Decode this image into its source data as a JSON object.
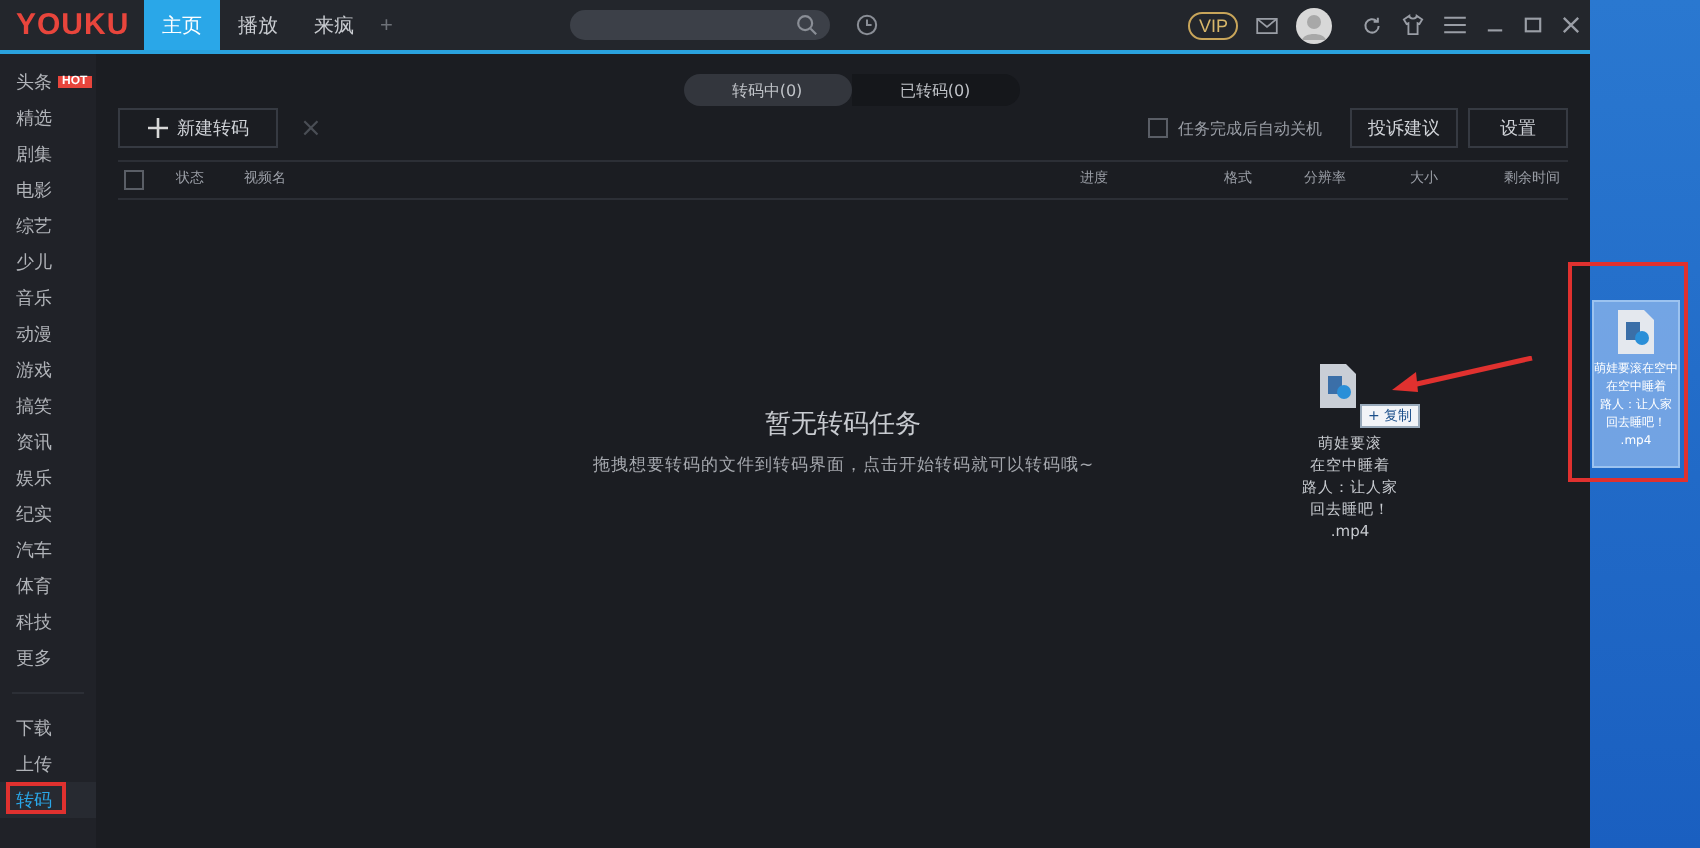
{
  "app": {
    "logo": "YOUKU",
    "nav_tabs": [
      {
        "label": "主页",
        "selected": true
      },
      {
        "label": "播放",
        "selected": false
      },
      {
        "label": "来疯",
        "selected": false
      }
    ],
    "add_tab": "+",
    "vip_badge": "VIP"
  },
  "sidebar": {
    "items": [
      {
        "label": "头条",
        "badge": "HOT",
        "selected": false
      },
      {
        "label": "精选",
        "selected": false
      },
      {
        "label": "剧集",
        "selected": false
      },
      {
        "label": "电影",
        "selected": false
      },
      {
        "label": "综艺",
        "selected": false
      },
      {
        "label": "少儿",
        "selected": false
      },
      {
        "label": "音乐",
        "selected": false
      },
      {
        "label": "动漫",
        "selected": false
      },
      {
        "label": "游戏",
        "selected": false
      },
      {
        "label": "搞笑",
        "selected": false
      },
      {
        "label": "资讯",
        "selected": false
      },
      {
        "label": "娱乐",
        "selected": false
      },
      {
        "label": "纪实",
        "selected": false
      },
      {
        "label": "汽车",
        "selected": false
      },
      {
        "label": "体育",
        "selected": false
      },
      {
        "label": "科技",
        "selected": false
      },
      {
        "label": "更多",
        "selected": false
      }
    ],
    "bottom_items": [
      {
        "label": "下载",
        "selected": false
      },
      {
        "label": "上传",
        "selected": false
      },
      {
        "label": "转码",
        "selected": true
      }
    ]
  },
  "segments": [
    {
      "label": "转码中(0)",
      "selected": true
    },
    {
      "label": "已转码(0)",
      "selected": false
    }
  ],
  "toolbar": {
    "new_button": "新建转码",
    "delete_icon": "×",
    "shutdown_option": {
      "label": "任务完成后自动关机",
      "checked": false
    },
    "buttons": [
      "投诉建议",
      "设置"
    ]
  },
  "table": {
    "select_all": {
      "checked": false
    },
    "columns": [
      "状态",
      "视频名",
      "进度",
      "格式",
      "分辨率",
      "大小",
      "剩余时间"
    ]
  },
  "empty_state": {
    "title": "暂无转码任务",
    "hint": "拖拽想要转码的文件到转码界面，点击开始转码就可以转码哦~"
  },
  "drag_file": {
    "name_lines": [
      "萌娃要滚",
      "在空中睡着",
      "路人：让人家",
      "回去睡吧！",
      ".mp4"
    ],
    "copy_badge": "+ 复制"
  },
  "desktop_file": {
    "name_lines": [
      "萌娃要滚在空中",
      "在空中睡着",
      "路人：让人家",
      "回去睡吧！",
      ".mp4"
    ]
  }
}
